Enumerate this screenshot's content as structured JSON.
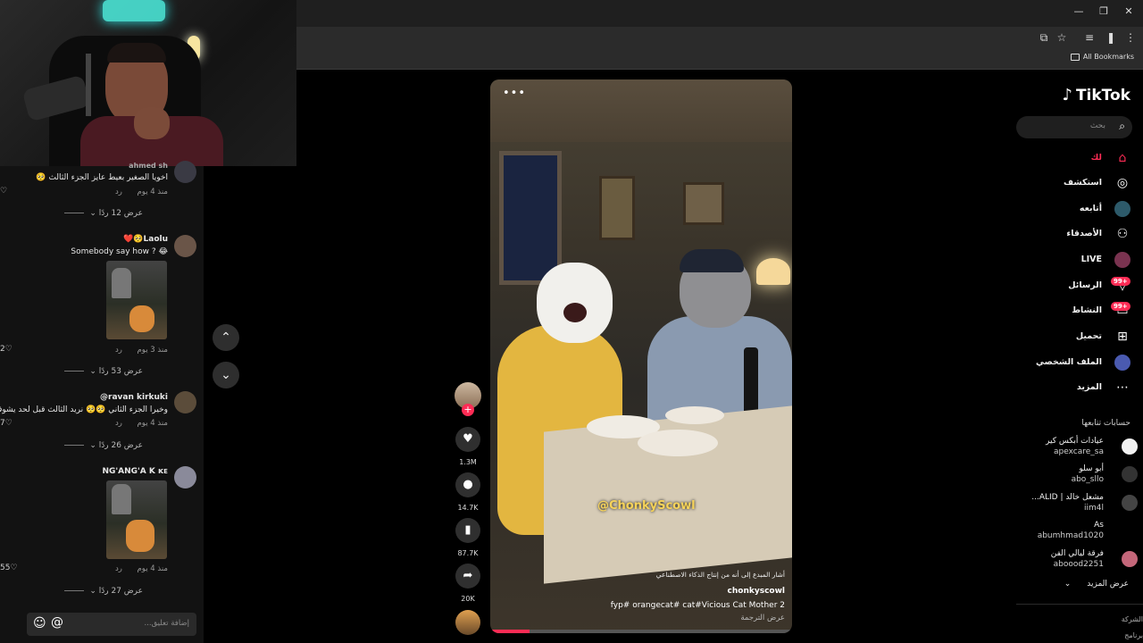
{
  "browser": {
    "all_bookmarks_label": "All Bookmarks"
  },
  "comments": [
    {
      "name": "ahmed sh",
      "text": "اخويا الصغير بعيط عايز الجزء الثالث 🥺",
      "time": "منذ 4 يوم",
      "reply": "رد",
      "view_replies": "عرض 12 ردًا"
    },
    {
      "name": "Laolu🥺❤️",
      "text": "Somebody say how ? 😂",
      "time": "منذ 3 يوم",
      "reply": "رد",
      "likes": "2",
      "view_replies": "عرض 53 ردًا"
    },
    {
      "name": "ravan kirkuki@",
      "text": "وخيرا الجزء الثاني 🥺🥺 نريد الثالث قبل لحد يشوفني",
      "time": "منذ 4 يوم",
      "reply": "رد",
      "likes": "7",
      "view_replies": "عرض 26 ردًا"
    },
    {
      "name": "NG'ANG'A K ᴋᴇ",
      "time": "منذ 4 يوم",
      "reply": "رد",
      "likes": "55",
      "view_replies": "عرض 27 ردًا"
    }
  ],
  "comment_input": {
    "placeholder": "إضافة تعليق..."
  },
  "video": {
    "watermark": "@ChonkyScowl",
    "ai_label": "أشار المبدع إلى أنه من إنتاج الذكاء الاصطناعي",
    "author": "chonkyscowl",
    "caption": "fyp# orangecat# cat#Vicious Cat Mother 2",
    "translate": "عرض الترجمة",
    "likes": "1.3M",
    "comments": "14.7K",
    "saves": "87.7K",
    "shares": "20K"
  },
  "sidebar": {
    "logo": "TikTok",
    "search_placeholder": "بحث",
    "nav": [
      {
        "label": "لك",
        "icon": "home-icon",
        "active": true
      },
      {
        "label": "استكشف",
        "icon": "compass-icon"
      },
      {
        "label": "أتابعه",
        "icon": "following-avatar-icon"
      },
      {
        "label": "الأصدقاء",
        "icon": "friends-icon"
      },
      {
        "label": "LIVE",
        "icon": "live-icon"
      },
      {
        "label": "الرسائل",
        "icon": "messages-icon",
        "badge": "99+"
      },
      {
        "label": "النشاط",
        "icon": "activity-icon",
        "badge": "99+"
      },
      {
        "label": "تحميل",
        "icon": "upload-icon"
      },
      {
        "label": "الملف الشخصي",
        "icon": "profile-avatar-icon"
      },
      {
        "label": "المزيد",
        "icon": "more-icon"
      }
    ],
    "following_title": "حسابات تتابعها",
    "following": [
      {
        "name": "عيادات أبكس كير",
        "handle": "apexcare_sa"
      },
      {
        "name": "أبو سلو",
        "handle": "abo_sllo"
      },
      {
        "name": "مشعل خالد | ALID...",
        "handle": "iim4l"
      },
      {
        "name": "As",
        "handle": "abumhmad1020"
      },
      {
        "name": "فرقة ليالي الفن",
        "handle": "aboood2251"
      }
    ],
    "see_more": "عرض المزيد",
    "footer_1": "الشركة",
    "footer_2": "برنامج"
  },
  "colors": {
    "accent": "#fe2c55",
    "panel": "#121212",
    "sidebar_bg": "#000000"
  }
}
